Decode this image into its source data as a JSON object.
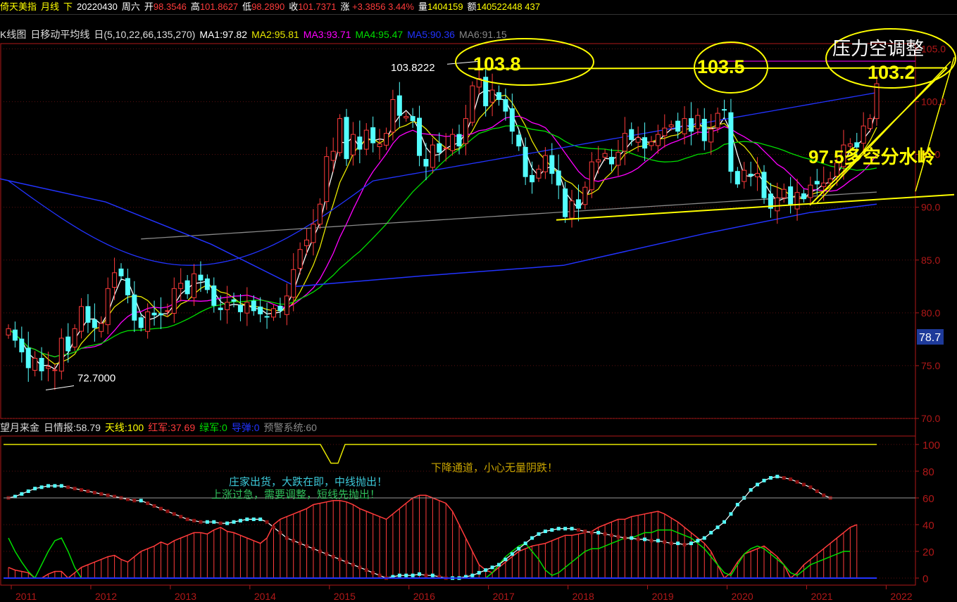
{
  "header": {
    "title": "倚天美指",
    "period": "月线",
    "direction": "下",
    "date": "20220430",
    "weekday": "周六",
    "open_label": "开",
    "open": "98.3546",
    "high_label": "高",
    "high": "101.8627",
    "low_label": "低",
    "low": "98.2890",
    "close_label": "收",
    "close": "101.7371",
    "change_label": "涨",
    "change": "+3.3856",
    "change_pct": "3.44%",
    "volume_label": "量",
    "volume": "1404159",
    "amount_label": "额",
    "amount": "140522448",
    "extra": "437"
  },
  "ma_bar": {
    "chart_name": "K线图",
    "ma_name": "日移动平均线",
    "params": "日(5,10,22,66,135,270)",
    "ma1": "MA1:97.82",
    "ma2": "MA2:95.81",
    "ma3": "MA3:93.71",
    "ma4": "MA4:95.47",
    "ma5": "MA5:90.36",
    "ma6": "MA6:91.15"
  },
  "lower_bar": {
    "name": "望月来金",
    "info": "日情报:58.79",
    "tianxian": "天线:100",
    "hongjun": "红军:37.69",
    "lvjun": "绿军:0",
    "daodan": "导弹:0",
    "yujing": "预警系统:60"
  },
  "annotations": {
    "peak_2017": "103.8",
    "peak_2020": "103.5",
    "resistance_title": "压力空调整",
    "resistance_value": "103.2",
    "watershed": "97.5多空分水岭",
    "high_label": "103.8222",
    "low_label": "72.7000",
    "current_price_tag": "78.7",
    "msg_down": "下降通道，小心无量阴跌！",
    "msg_dealer": "庄家出货，大跌在即，中线抛出！",
    "msg_up": "上涨过急，需要调整，短线先抛出！"
  },
  "colors": {
    "up": "#ff3b3b",
    "down": "#54ffff",
    "ma1": "#ffffff",
    "ma2": "#e6e600",
    "ma3": "#ff00ff",
    "ma4": "#00dd00",
    "ma5": "#2233ff",
    "ma6": "#888888",
    "axis": "#b01818",
    "annotation": "#ffff00"
  },
  "chart_data": {
    "type": "candlestick",
    "title": "倚天美指 月线",
    "x_ticks": [
      "2011",
      "2012",
      "2013",
      "2014",
      "2015",
      "2016",
      "2017",
      "2018",
      "2019",
      "2020",
      "2021",
      "2022"
    ],
    "y_ticks": [
      "105.0",
      "100.0",
      "95.0",
      "90.0",
      "85.0",
      "80.0",
      "75.0",
      "70.0"
    ],
    "ylim": [
      70,
      105.5
    ],
    "lower_y_ticks": [
      "100",
      "80",
      "60",
      "40",
      "20",
      "0"
    ],
    "lower_ylim": [
      0,
      100
    ],
    "ohlc_approx": {
      "start": "2011-01",
      "closes": [
        78.5,
        77.4,
        76.3,
        74.8,
        75.7,
        74.5,
        74.9,
        74.6,
        77.6,
        76.4,
        78.5,
        80.6,
        79.1,
        78.6,
        79.0,
        82.3,
        83.8,
        83.5,
        81.7,
        79.3,
        78.6,
        80.1,
        79.8,
        79.8,
        80.2,
        82.3,
        82.8,
        81.8,
        83.7,
        83.1,
        82.2,
        80.7,
        80.3,
        81.0,
        81.1,
        80.1,
        81.0,
        80.2,
        79.9,
        79.6,
        80.4,
        80.2,
        81.6,
        84.1,
        86.0,
        86.9,
        88.4,
        90.3,
        94.8,
        95.3,
        98.4,
        94.6,
        96.9,
        95.5,
        97.3,
        96.1,
        96.0,
        97.0,
        100.2,
        98.7,
        98.6,
        98.2,
        94.9,
        93.9,
        95.9,
        95.2,
        95.6,
        96.9,
        95.8,
        98.4,
        101.5,
        102.2,
        99.6,
        101.1,
        100.2,
        99.1,
        97.2,
        95.8,
        92.9,
        92.4,
        93.6,
        94.9,
        93.2,
        92.1,
        89.1,
        90.6,
        89.9,
        91.9,
        94.3,
        94.5,
        95.1,
        94.1,
        95.2,
        97.0,
        96.4,
        96.6,
        95.6,
        96.2,
        96.9,
        97.5,
        97.8,
        97.2,
        98.4,
        97.2,
        98.7,
        96.3,
        97.4,
        98.9,
        99.2,
        93.4,
        92.2,
        93.5,
        93.0,
        93.2,
        90.9,
        89.9,
        90.9,
        91.7,
        90.2,
        91.4,
        90.8,
        92.1,
        92.2,
        92.3,
        92.7,
        94.2,
        95.9,
        96.0,
        95.7,
        97.7,
        98.4,
        101.7
      ]
    },
    "series": [
      {
        "name": "MA1",
        "value": 97.82
      },
      {
        "name": "MA2",
        "value": 95.81
      },
      {
        "name": "MA3",
        "value": 93.71
      },
      {
        "name": "MA4",
        "value": 95.47
      },
      {
        "name": "MA5",
        "value": 90.36
      },
      {
        "name": "MA6",
        "value": 91.15
      }
    ],
    "lower_indicator": {
      "name": "望月来金",
      "values": {
        "情报": 58.79,
        "天线": 100,
        "红军": 37.69,
        "绿军": 0,
        "导弹": 0,
        "预警系统": 60
      }
    },
    "trendlines": [
      {
        "label": "103.8",
        "from": "2016-12",
        "to": "2020-03",
        "value": 103.8
      },
      {
        "label": "103.5",
        "from": "2020-03",
        "to": "2022-04",
        "value": 103.5
      },
      {
        "label": "103.2"
      },
      {
        "label": "97.5多空分水岭"
      }
    ]
  }
}
